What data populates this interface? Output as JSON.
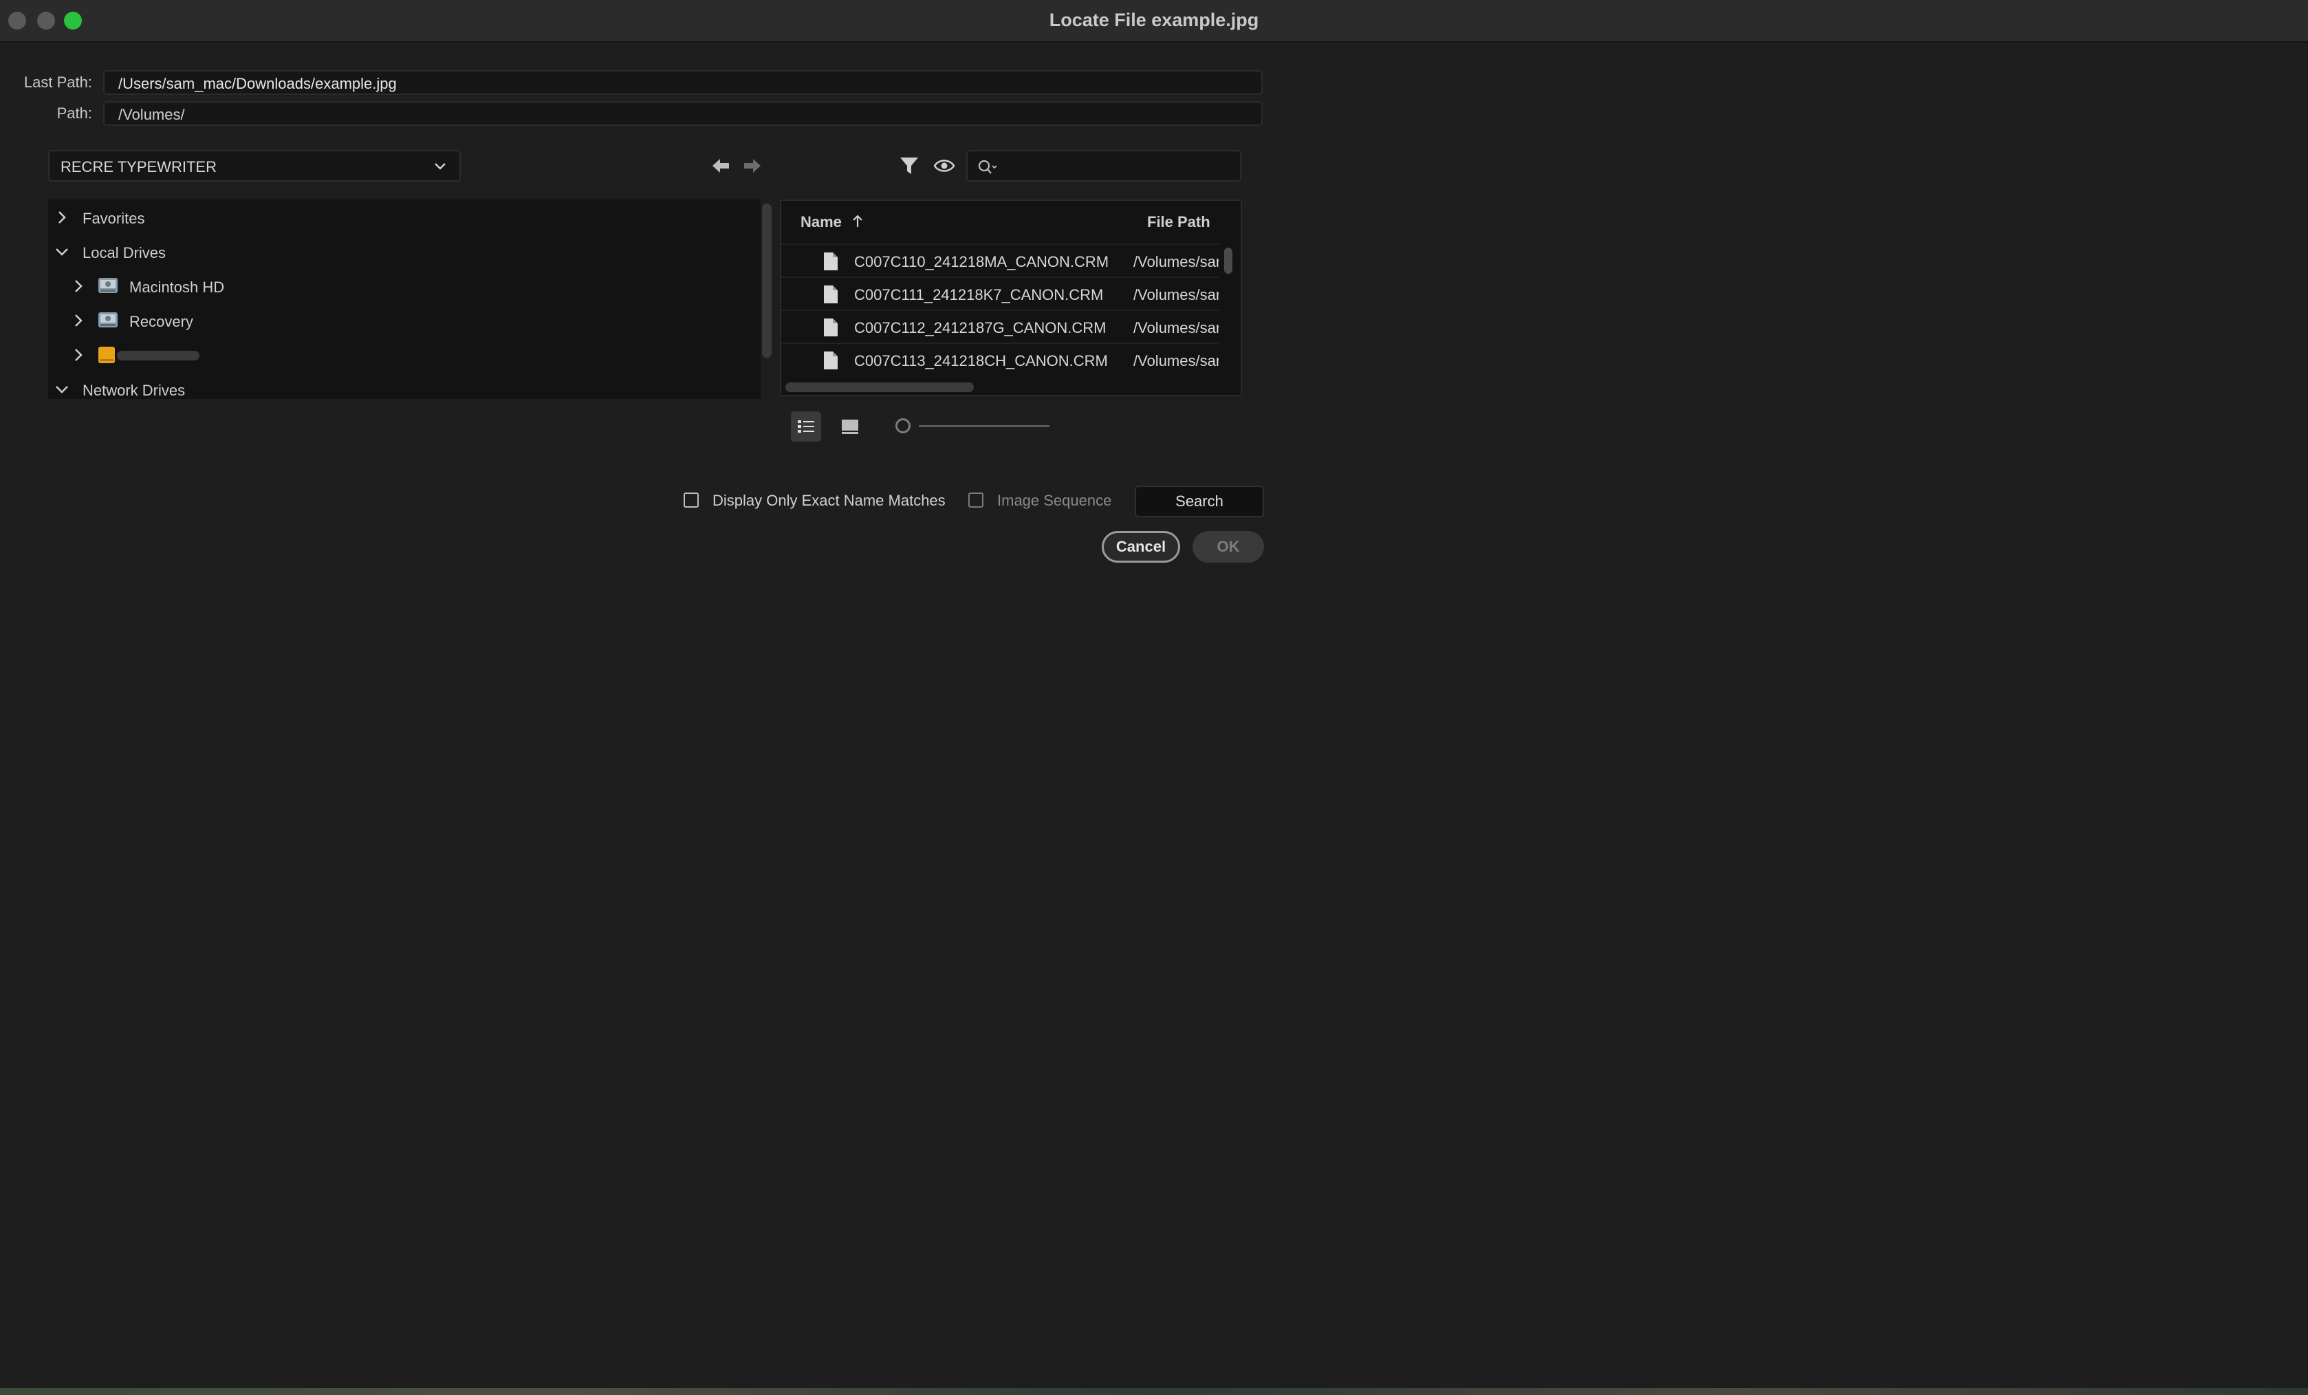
{
  "window": {
    "title": "Locate File example.jpg"
  },
  "paths": {
    "last_path_label": "Last Path:",
    "last_path_value": "/Users/sam_mac/Downloads/example.jpg",
    "path_label": "Path:",
    "path_value": "/Volumes/"
  },
  "location_dropdown": {
    "selected": "RECRE TYPEWRITER"
  },
  "tree": {
    "items": [
      {
        "label": "Favorites",
        "expanded": false,
        "icon": "chevron-right-icon"
      },
      {
        "label": "Local Drives",
        "expanded": true,
        "icon": "chevron-down-icon"
      },
      {
        "label": "Macintosh HD",
        "icon": "hard-drive-icon"
      },
      {
        "label": "Recovery",
        "icon": "hard-drive-icon"
      },
      {
        "label": "",
        "icon": "external-drive-icon"
      },
      {
        "label": "Network Drives",
        "expanded": true,
        "icon": "chevron-down-icon"
      }
    ]
  },
  "file_list": {
    "columns": {
      "name": "Name",
      "file_path": "File Path"
    },
    "sort": "ascending",
    "rows": [
      {
        "name": "C007C110_241218MA_CANON.CRM",
        "path": "/Volumes/sam"
      },
      {
        "name": "C007C111_241218K7_CANON.CRM",
        "path": "/Volumes/sam"
      },
      {
        "name": "C007C112_2412187G_CANON.CRM",
        "path": "/Volumes/sam"
      },
      {
        "name": "C007C113_241218CH_CANON.CRM",
        "path": "/Volumes/sam"
      }
    ]
  },
  "options": {
    "exact_match_label": "Display Only Exact Name Matches",
    "exact_match_checked": false,
    "image_sequence_label": "Image Sequence",
    "image_sequence_checked": false
  },
  "buttons": {
    "search": "Search",
    "cancel": "Cancel",
    "ok": "OK"
  },
  "colors": {
    "zoom_button": "#29c23f",
    "drive_icon": "#e8a317"
  }
}
